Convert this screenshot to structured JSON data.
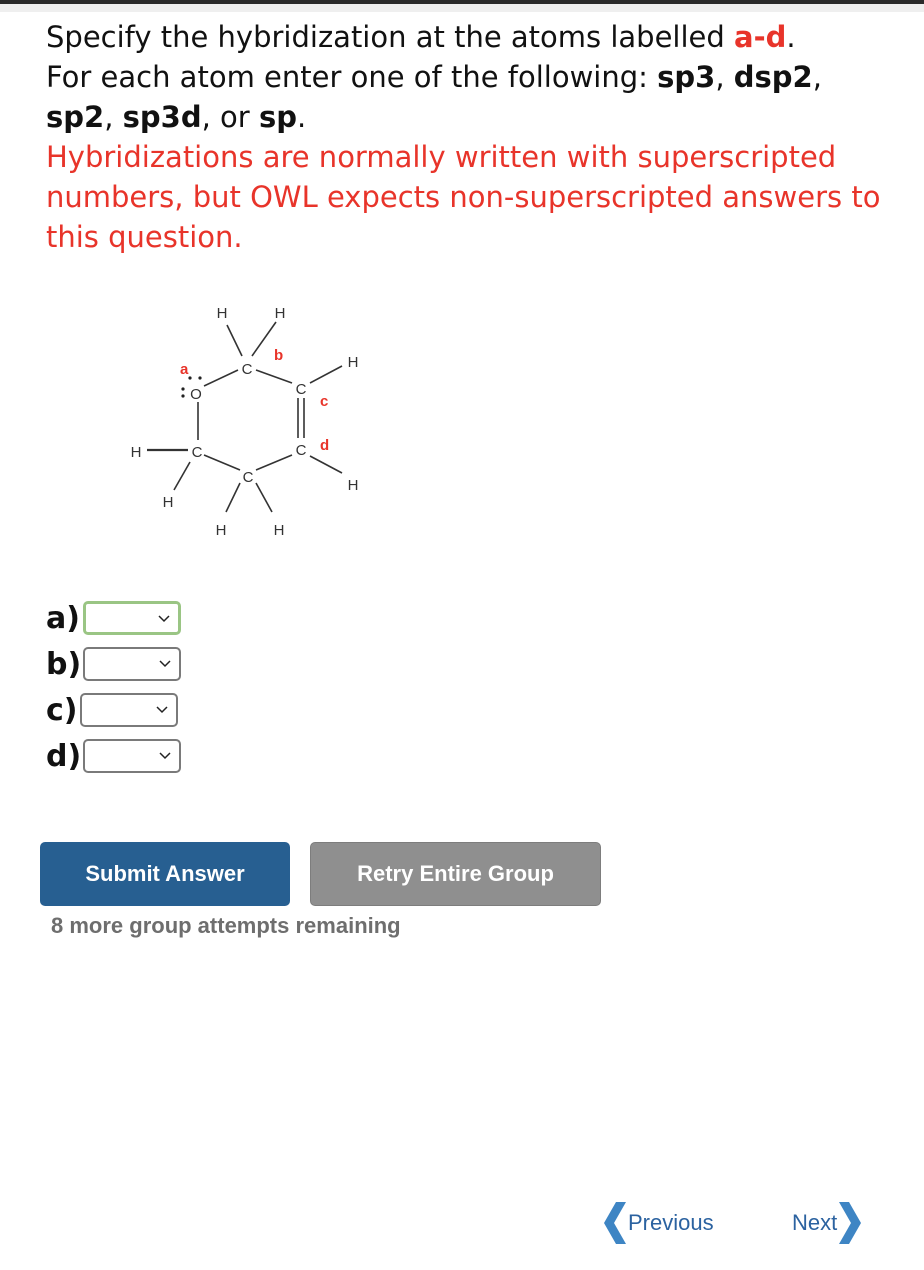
{
  "question": {
    "line1_prefix": "Specify the hybridization at the atoms labelled ",
    "line1_highlight": "a-d",
    "line1_suffix": ".",
    "line2_prefix": "For each atom enter one of the following: ",
    "options_text": [
      "sp3",
      "dsp2",
      "sp2",
      "sp3d",
      "sp"
    ],
    "sep": ", ",
    "or_text": ", or ",
    "end": ".",
    "note": "Hybridizations are normally written with superscripted numbers, but OWL expects non-superscripted answers to this question."
  },
  "molecule": {
    "atoms": {
      "O": "O",
      "C": "C",
      "H": "H"
    },
    "labels": [
      "a",
      "b",
      "c",
      "d"
    ],
    "label_color": "#e8342a"
  },
  "answers": [
    {
      "label": "a)",
      "value": "",
      "focused": true
    },
    {
      "label": "b)",
      "value": "",
      "focused": false
    },
    {
      "label": "c)",
      "value": "",
      "focused": false
    },
    {
      "label": "d)",
      "value": "",
      "focused": false
    }
  ],
  "buttons": {
    "submit": "Submit Answer",
    "retry": "Retry Entire Group"
  },
  "attempts_text": "8 more group attempts remaining",
  "nav": {
    "previous": "Previous",
    "next": "Next"
  },
  "colors": {
    "accent_red": "#e8342a",
    "submit_blue": "#275f91",
    "retry_gray": "#8f8f8f",
    "nav_blue": "#2b62a0",
    "focus_green": "#9ac584"
  }
}
